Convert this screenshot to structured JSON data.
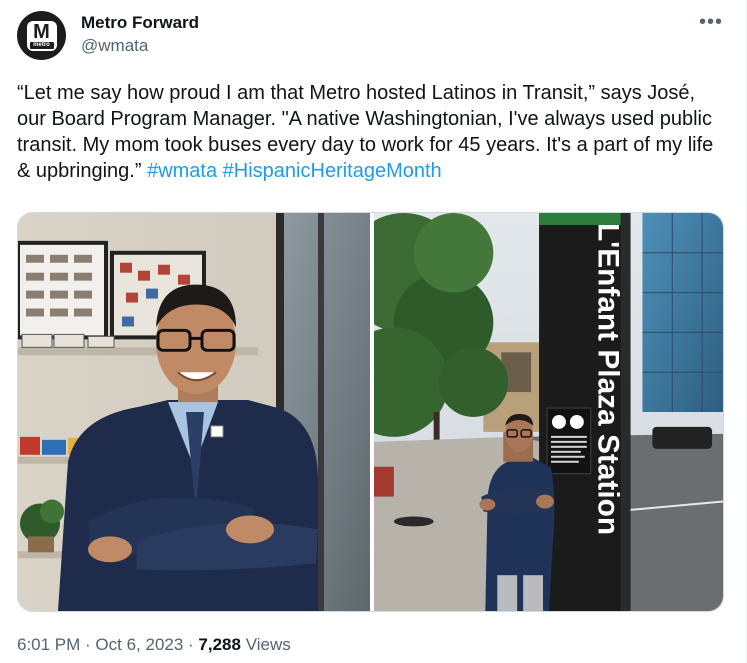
{
  "account": {
    "display_name": "Metro Forward",
    "handle": "@wmata",
    "avatar_letter": "M",
    "avatar_sub": "metro"
  },
  "more_label": "•••",
  "tweet": {
    "text_before": "“Let me say how proud I am that Metro hosted Latinos in Transit,” says José, our Board Program Manager. \"A native Washingtonian, I've always used public transit. My mom took buses every day to work for 45 years. It's a part of my life & upbringing.” ",
    "hashtag1": "#wmata",
    "hashtag2": "#HispanicHeritageMonth"
  },
  "media": {
    "station_sign": "L'Enfant Plaza Station",
    "sign_notice": "ACCESSIBLE ENTRANCE AT 7TH AND D ST ACROSS FROM METRO ESCALATOR ENTRANCE"
  },
  "footer": {
    "time": "6:01 PM",
    "sep1": " · ",
    "date": "Oct 6, 2023",
    "sep2": " · ",
    "views_count": "7,288",
    "views_label": " Views"
  }
}
